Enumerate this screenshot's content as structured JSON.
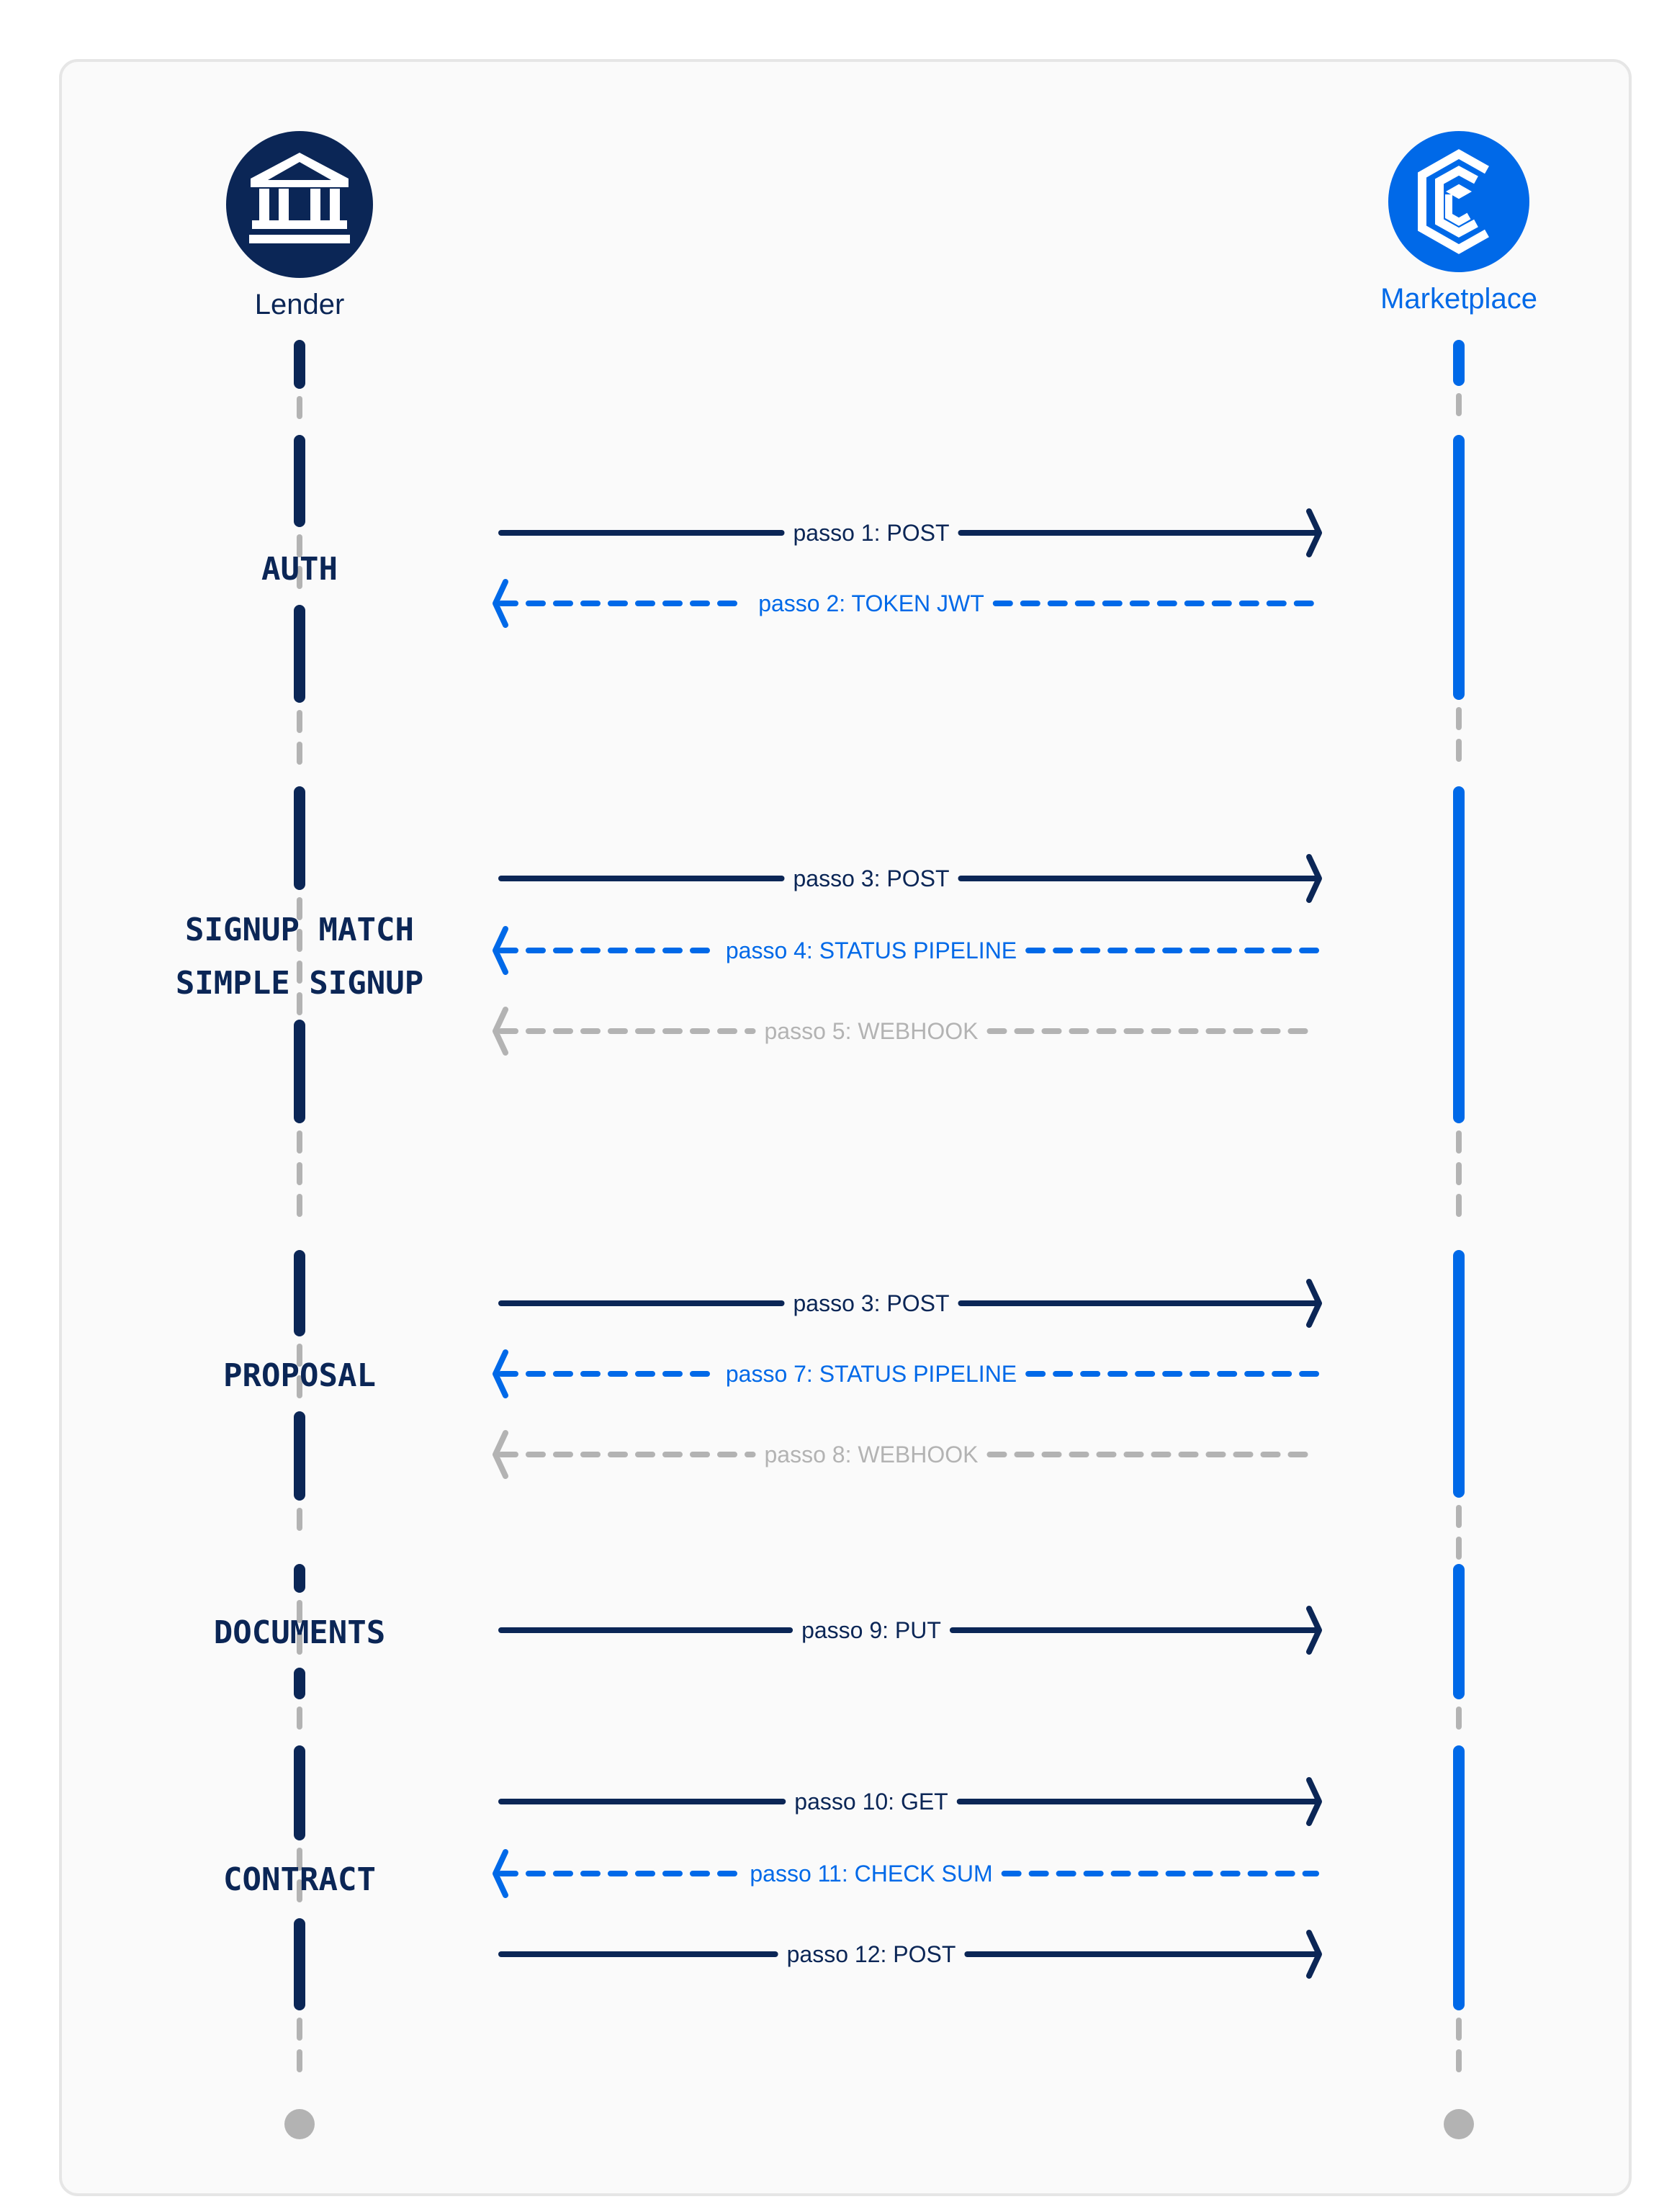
{
  "colors": {
    "dark": "#0b2656",
    "blue": "#0069e8",
    "gray": "#b3b3b3",
    "frame_bg": "#fafafa",
    "frame_border": "#e6e6e6"
  },
  "actors": [
    {
      "id": "lender",
      "label": "Lender",
      "icon": "bank-icon",
      "color": "#0b2656"
    },
    {
      "id": "marketplace",
      "label": "Marketplace",
      "icon": "hexagon-c-logo-icon",
      "color": "#0069e8"
    }
  ],
  "sections": [
    {
      "id": "auth",
      "lines": [
        "AUTH"
      ]
    },
    {
      "id": "signup",
      "lines": [
        "SIGNUP MATCH",
        "SIMPLE SIGNUP"
      ]
    },
    {
      "id": "proposal",
      "lines": [
        "PROPOSAL"
      ]
    },
    {
      "id": "documents",
      "lines": [
        "DOCUMENTS"
      ]
    },
    {
      "id": "contract",
      "lines": [
        "CONTRACT"
      ]
    }
  ],
  "messages": [
    {
      "label": "passo 1: POST",
      "direction": "to-marketplace",
      "style": "solid",
      "tone": "dark",
      "section": "auth"
    },
    {
      "label": "passo 2: TOKEN JWT",
      "direction": "to-lender",
      "style": "dashed",
      "tone": "blue",
      "section": "auth"
    },
    {
      "label": "passo 3: POST",
      "direction": "to-marketplace",
      "style": "solid",
      "tone": "dark",
      "section": "signup"
    },
    {
      "label": "passo 4: STATUS PIPELINE",
      "direction": "to-lender",
      "style": "dashed",
      "tone": "blue",
      "section": "signup"
    },
    {
      "label": "passo 5: WEBHOOK",
      "direction": "to-lender",
      "style": "dashed",
      "tone": "gray",
      "section": "signup"
    },
    {
      "label": "passo 3: POST",
      "direction": "to-marketplace",
      "style": "solid",
      "tone": "dark",
      "section": "proposal"
    },
    {
      "label": "passo 7: STATUS PIPELINE",
      "direction": "to-lender",
      "style": "dashed",
      "tone": "blue",
      "section": "proposal"
    },
    {
      "label": "passo 8: WEBHOOK",
      "direction": "to-lender",
      "style": "dashed",
      "tone": "gray",
      "section": "proposal"
    },
    {
      "label": "passo 9: PUT",
      "direction": "to-marketplace",
      "style": "solid",
      "tone": "dark",
      "section": "documents"
    },
    {
      "label": "passo 10: GET",
      "direction": "to-marketplace",
      "style": "solid",
      "tone": "dark",
      "section": "contract"
    },
    {
      "label": "passo 11: CHECK SUM",
      "direction": "to-lender",
      "style": "dashed",
      "tone": "blue",
      "section": "contract"
    },
    {
      "label": "passo 12: POST",
      "direction": "to-marketplace",
      "style": "solid",
      "tone": "dark",
      "section": "contract"
    }
  ]
}
